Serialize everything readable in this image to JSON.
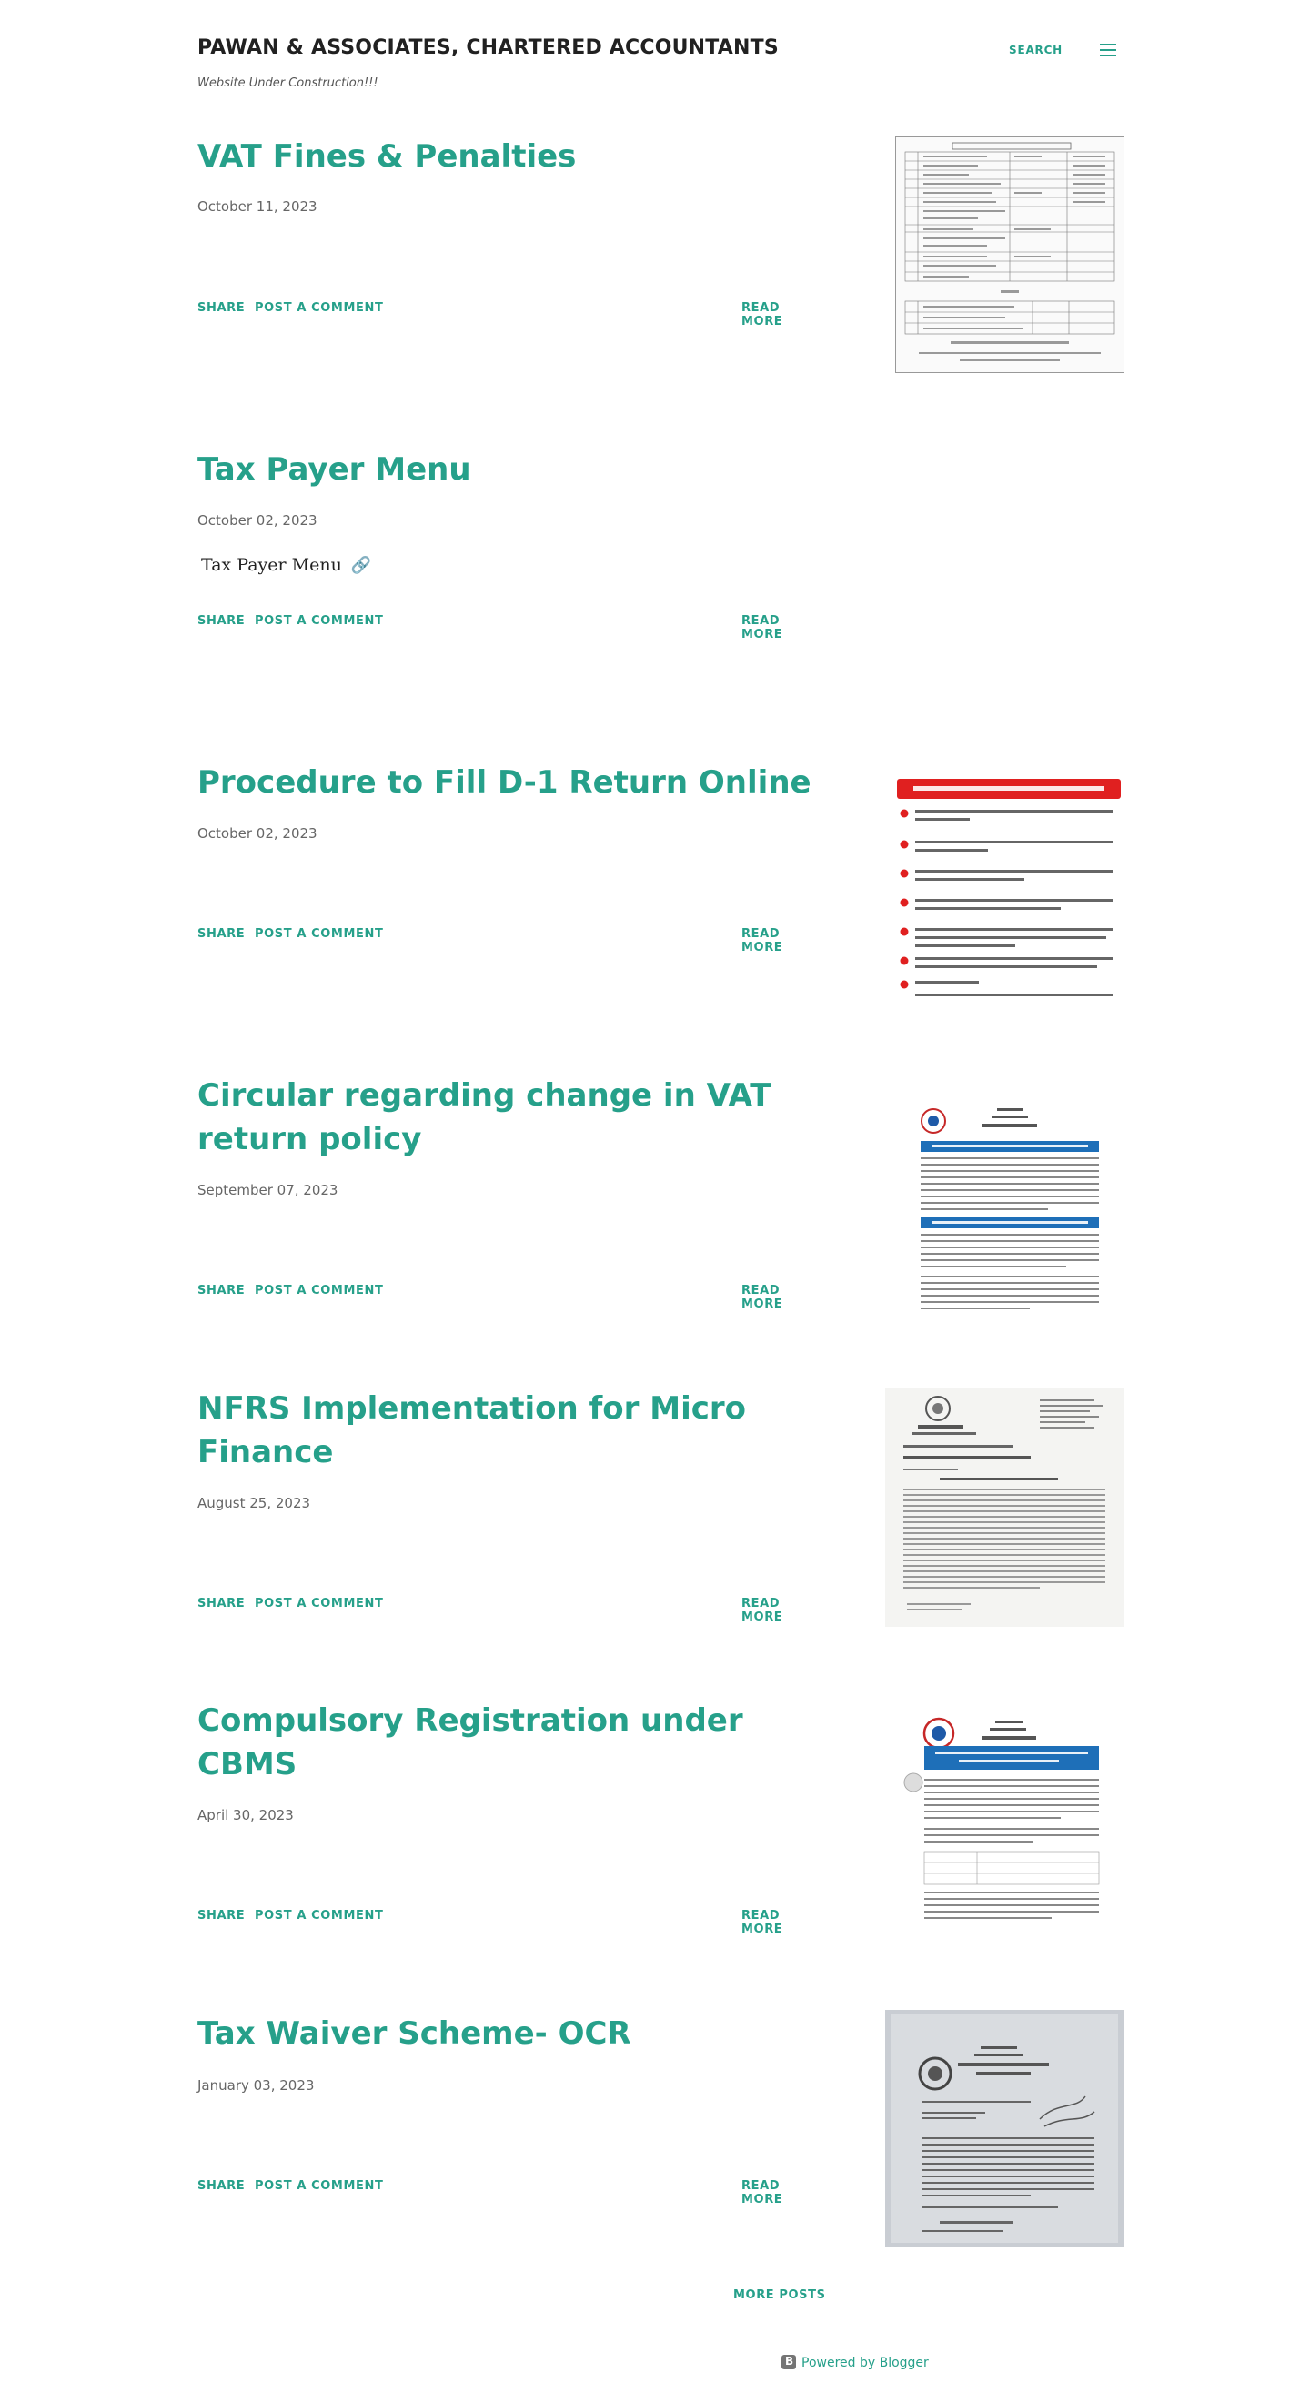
{
  "header": {
    "title": "PAWAN & ASSOCIATES, CHARTERED ACCOUNTANTS",
    "description": "Website Under Construction!!!",
    "search_label": "SEARCH",
    "menu_icon": "hamburger-menu-icon"
  },
  "posts": [
    {
      "title": "VAT Fines & Penalties",
      "date": "October 11, 2023",
      "share": "SHARE",
      "comment": "POST A COMMENT",
      "read_more": "READ MORE",
      "thumbnail": "document-table-thumbnail"
    },
    {
      "title": "Tax Payer Menu",
      "date": "October 02, 2023",
      "snippet": "Tax Payer Menu",
      "share": "SHARE",
      "comment": "POST A COMMENT",
      "read_more": "READ MORE"
    },
    {
      "title": "Procedure to Fill D-1 Return Online",
      "date": "October 02, 2023",
      "share": "SHARE",
      "comment": "POST A COMMENT",
      "read_more": "READ MORE",
      "thumbnail": "infographic-thumbnail"
    },
    {
      "title": "Circular regarding change in VAT return policy",
      "date": "September 07, 2023",
      "share": "SHARE",
      "comment": "POST A COMMENT",
      "read_more": "READ MORE",
      "thumbnail": "notice-thumbnail"
    },
    {
      "title": "NFRS Implementation for Micro Finance",
      "date": "August 25, 2023",
      "share": "SHARE",
      "comment": "POST A COMMENT",
      "read_more": "READ MORE",
      "thumbnail": "letter-thumbnail"
    },
    {
      "title": "Compulsory Registration under CBMS",
      "date": "April 30, 2023",
      "share": "SHARE",
      "comment": "POST A COMMENT",
      "read_more": "READ MORE",
      "thumbnail": "notice-thumbnail"
    },
    {
      "title": "Tax Waiver Scheme- OCR",
      "date": "January 03, 2023",
      "share": "SHARE",
      "comment": "POST A COMMENT",
      "read_more": "READ MORE",
      "thumbnail": "scanned-letter-thumbnail"
    }
  ],
  "footer": {
    "more_posts": "MORE POSTS",
    "powered_by": "Powered by Blogger"
  },
  "colors": {
    "accent": "#26a08a",
    "title": "#212121",
    "text": "#666666"
  }
}
